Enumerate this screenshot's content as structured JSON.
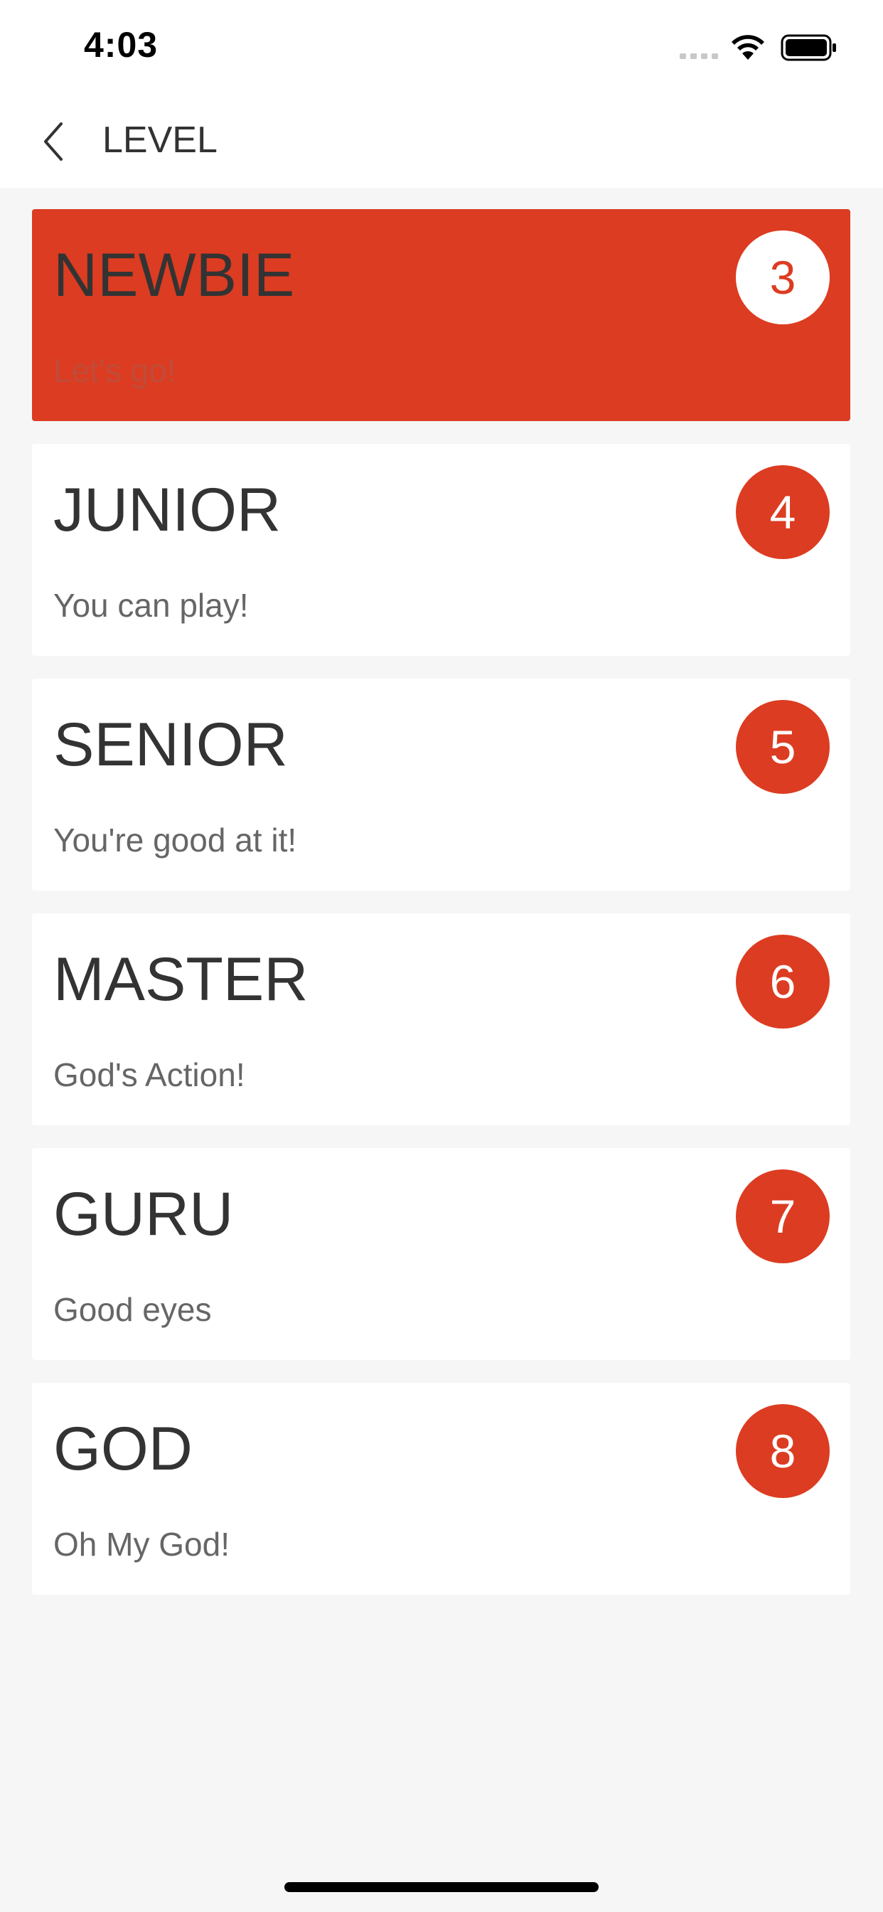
{
  "status_bar": {
    "time": "4:03"
  },
  "nav": {
    "title": "LEVEL"
  },
  "colors": {
    "accent": "#dc3c21",
    "background": "#f6f6f6",
    "card": "#ffffff",
    "title_text": "#333333",
    "desc_text": "#666666"
  },
  "levels": [
    {
      "name": "NEWBIE",
      "description": "Let's go!",
      "badge": "3",
      "selected": true
    },
    {
      "name": "JUNIOR",
      "description": "You can play!",
      "badge": "4",
      "selected": false
    },
    {
      "name": "SENIOR",
      "description": "You're good at it!",
      "badge": "5",
      "selected": false
    },
    {
      "name": "MASTER",
      "description": "God's Action!",
      "badge": "6",
      "selected": false
    },
    {
      "name": "GURU",
      "description": "Good eyes",
      "badge": "7",
      "selected": false
    },
    {
      "name": "GOD",
      "description": "Oh My God!",
      "badge": "8",
      "selected": false
    }
  ]
}
